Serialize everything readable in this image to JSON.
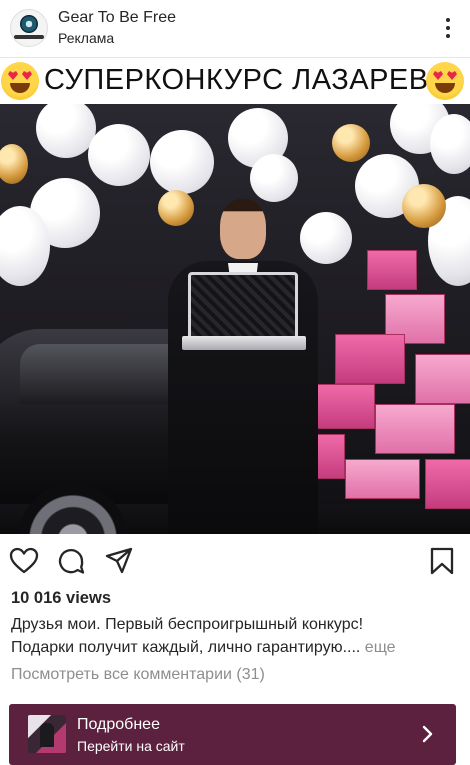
{
  "header": {
    "account_name": "Gear To Be Free",
    "sponsored_label": "Реклама",
    "avatar_icon": "brand-logo-avatar",
    "more_icon": "more-vertical-icon"
  },
  "media": {
    "title_text": "СУПЕРКОНКУРС ЛАЗАРЕВА",
    "left_emoji_icon": "heart-eyes-emoji-icon",
    "right_emoji_icon": "heart-eyes-emoji-icon"
  },
  "actions": {
    "like_icon": "heart-icon",
    "comment_icon": "comment-icon",
    "share_icon": "paper-plane-icon",
    "save_icon": "bookmark-icon"
  },
  "post": {
    "views": "10 016 views",
    "caption_line1": "Друзья мои. Первый беспроигрышный конкурс!",
    "caption_line2": "Подарки получит каждый, лично гарантирую....",
    "more_label": "еще",
    "view_comments": "Посмотреть все комментарии (31)"
  },
  "cta": {
    "title": "Подробнее",
    "subtitle": "Перейти на сайт",
    "arrow_icon": "chevron-right-icon",
    "background_color": "#5b213f"
  }
}
